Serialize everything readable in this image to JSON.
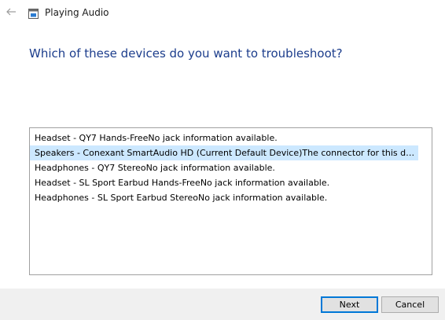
{
  "window": {
    "title": "Playing Audio",
    "back_icon": "back-arrow-icon",
    "app_icon": "troubleshooter-icon"
  },
  "main": {
    "heading": "Which of these devices do you want to troubleshoot?",
    "devices": [
      "Headset - QY7 Hands-FreeNo jack information available.",
      "Speakers - Conexant SmartAudio HD (Current Default Device)The connector for this devic...",
      "Headphones - QY7 StereoNo jack information available.",
      "Headset - SL Sport Earbud Hands-FreeNo jack information available.",
      "Headphones - SL Sport Earbud StereoNo jack information available."
    ],
    "selected_index": 1
  },
  "footer": {
    "next_label": "Next",
    "cancel_label": "Cancel"
  },
  "colors": {
    "heading": "#1c3d8c",
    "selection": "#cce8ff",
    "default_button_border": "#0078d7",
    "footer_background": "#f0f0f0"
  }
}
